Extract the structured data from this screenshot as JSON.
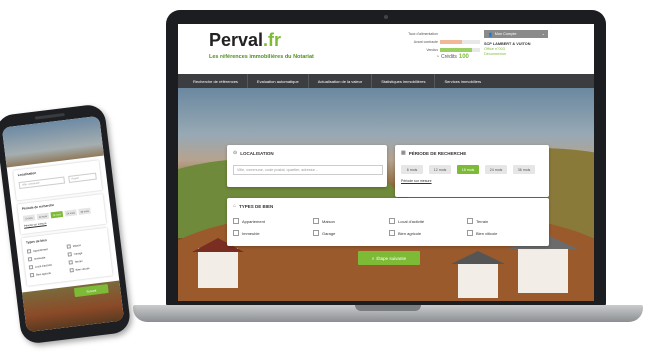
{
  "site": {
    "logo_main": "Perval",
    "logo_suffix": ".fr",
    "tagline": "Les références immobilières du Notariat"
  },
  "usage": {
    "title": "Taux d'alimentation",
    "rows": [
      {
        "label": "Avant contracte",
        "fill": 0.55,
        "color": "#f0b896"
      },
      {
        "label": "Vendus",
        "fill": 0.8,
        "color": "#9ccf63"
      }
    ],
    "credits_label": "Crédits",
    "credits_value": "100"
  },
  "account": {
    "button_label": "Mon Compte",
    "office": "SCP LAMBERT & VUITON",
    "line2": "Office n°003",
    "logout": "Déconnexion"
  },
  "nav": {
    "items": [
      "Recherche de références",
      "Evaluation automatique",
      "Actualisation de la valeur",
      "Statistiques immobilières",
      "Services immobiliers"
    ]
  },
  "search": {
    "location_title": "LOCALISATION",
    "location_placeholder": "Ville, commune, code postal, quartier, adresse...",
    "period_title": "PÉRIODE DE RECHERCHE",
    "periods": [
      "6 mois",
      "12 mois",
      "18 mois",
      "24 mois",
      "36 mois"
    ],
    "active_period": "18 mois",
    "period_link": "Période sur mesure",
    "types_title": "TYPES DE BIEN",
    "types": [
      "Appartement",
      "Maison",
      "Local d'activité",
      "Terrain",
      "Immeuble",
      "Garage",
      "Bien agricole",
      "Bien viticole"
    ],
    "next_button": "Étape suivante"
  },
  "phone": {
    "location_title": "Localisation",
    "location_placeholder": "Ville, commune",
    "location_button": "Rayon",
    "period_title": "Période de recherche",
    "periods": [
      "6 mois",
      "12 mois",
      "18 mois",
      "24 mois",
      "36 mois"
    ],
    "active_period": "18 mois",
    "period_link": "Période sur mesure",
    "types_title": "Types de bien",
    "types": [
      "Appartement",
      "Maison",
      "Immeuble",
      "Garage",
      "Local d'activité",
      "Terrain",
      "Bien agricole",
      "Bien viticole"
    ],
    "next_button": "Suivant"
  },
  "colors": {
    "brand_green": "#7dbb36",
    "nav_dark": "#3b3d40"
  }
}
